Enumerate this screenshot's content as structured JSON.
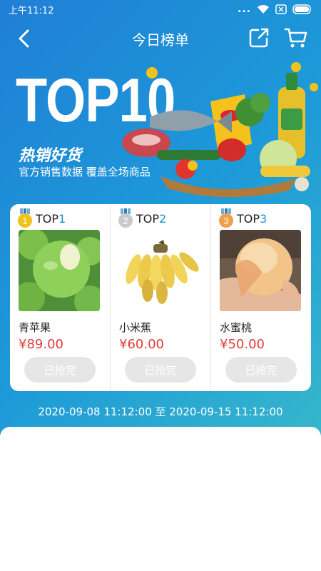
{
  "status_bar": {
    "time": "上午11:12",
    "dots": "..."
  },
  "nav": {
    "title": "今日榜单"
  },
  "banner": {
    "headline": "TOP10",
    "subtitle": "热销好货",
    "description": "官方销售数据  覆盖全场商品"
  },
  "products": [
    {
      "rank_prefix": "TOP",
      "rank": "1",
      "medal_num": "1",
      "medal_color": "#f2c21c",
      "name": "青苹果",
      "price": "¥89.00",
      "button": "已抢完"
    },
    {
      "rank_prefix": "TOP",
      "rank": "2",
      "medal_num": "2",
      "medal_color": "#c9c9c9",
      "name": "小米蕉",
      "price": "¥60.00",
      "button": "已抢完"
    },
    {
      "rank_prefix": "TOP",
      "rank": "3",
      "medal_num": "3",
      "medal_color": "#f0a04b",
      "name": "水蜜桃",
      "price": "¥50.00",
      "button": "已抢完"
    }
  ],
  "date_range": "2020-09-08 11:12:00 至 2020-09-15 11:12:00",
  "colors": {
    "price": "#e23a3a",
    "accent": "#1a8fd6",
    "disabled_button": "#e6e6e6"
  },
  "icons": [
    "back-arrow-icon",
    "share-icon",
    "cart-icon",
    "wifi-icon",
    "battery-icon"
  ]
}
